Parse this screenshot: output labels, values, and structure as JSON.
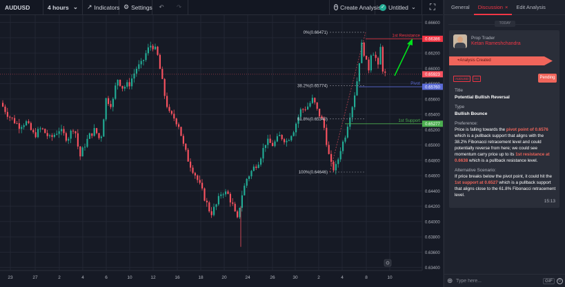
{
  "toolbar": {
    "symbol": "AUDUSD",
    "interval": "4 hours",
    "indicators": "Indicators",
    "settings": "Settings",
    "create_analysis": "Create Analysis",
    "untitled": "Untitled"
  },
  "chart": {
    "price_axis": [
      "0.66600",
      "0.66400",
      "0.66200",
      "0.66000",
      "0.65800",
      "0.65600",
      "0.65400",
      "0.65200",
      "0.65000",
      "0.64800",
      "0.64600",
      "0.64400",
      "0.64200",
      "0.64000",
      "0.63800",
      "0.63600",
      "0.63400"
    ],
    "time_axis": [
      "23",
      "27",
      "2",
      "4",
      "6",
      "10",
      "12",
      "16",
      "18",
      "20",
      "24",
      "26",
      "30",
      "2",
      "4",
      "8",
      "10"
    ],
    "fib_labels": {
      "top": "0%(0.66471)",
      "mid": "38.2%(0.65774)",
      "low": "61.8%(0.65340)",
      "bottom": "100%(0.64646)"
    },
    "levels": {
      "resistance_label": "1st Resistance",
      "pivot_label": "Pivot",
      "support_label": "1st Support"
    },
    "price_tags": {
      "resistance": "0.66386",
      "current": "0.65923",
      "pivot": "0.65760",
      "support": "0.65277"
    },
    "colors": {
      "up": "#22ab94",
      "down": "#f7525f",
      "resistance": "#f23645",
      "pivot": "#5b6bd6",
      "support": "#4caf50",
      "arrow": "#00e21b"
    }
  },
  "panel": {
    "tabs": [
      "General",
      "Discussion",
      "Edit Analysis"
    ],
    "today": "TODAY",
    "role": "Prop Trader",
    "author": "Ketan Rameshchandra",
    "created": "Analysis Created",
    "chips": [
      "AUDUSD",
      "H4"
    ],
    "status": "Pending",
    "title_label": "Title",
    "title_value": "Potential Bullish Reversal",
    "type_label": "Type",
    "type_value": "Bullish Bounce",
    "preference_label": "Preference:",
    "preference_parts": [
      {
        "t": "Price is falling towards the "
      },
      {
        "t": "pivot point of 0.6576",
        "hl": true
      },
      {
        "t": " which is a pullback support that aligns with the 38.2% Fibonacci retracement level and could potentially reverse from here; we could see momentum carry price up to its "
      },
      {
        "t": "1st resistance at 0.6638",
        "hl": true
      },
      {
        "t": " which is a pullback resistance level."
      }
    ],
    "alt_label": "Alternative Scenario:",
    "alt_parts": [
      {
        "t": "If price breaks below the pivot point, it could hit the "
      },
      {
        "t": "1st support at 0.6527",
        "hl": true
      },
      {
        "t": " which is a pullback support that aligns close to the 61.8% Fibonacci retracement level."
      }
    ],
    "time": "15:13",
    "input_placeholder": "Type here...",
    "gif": "GIF"
  }
}
